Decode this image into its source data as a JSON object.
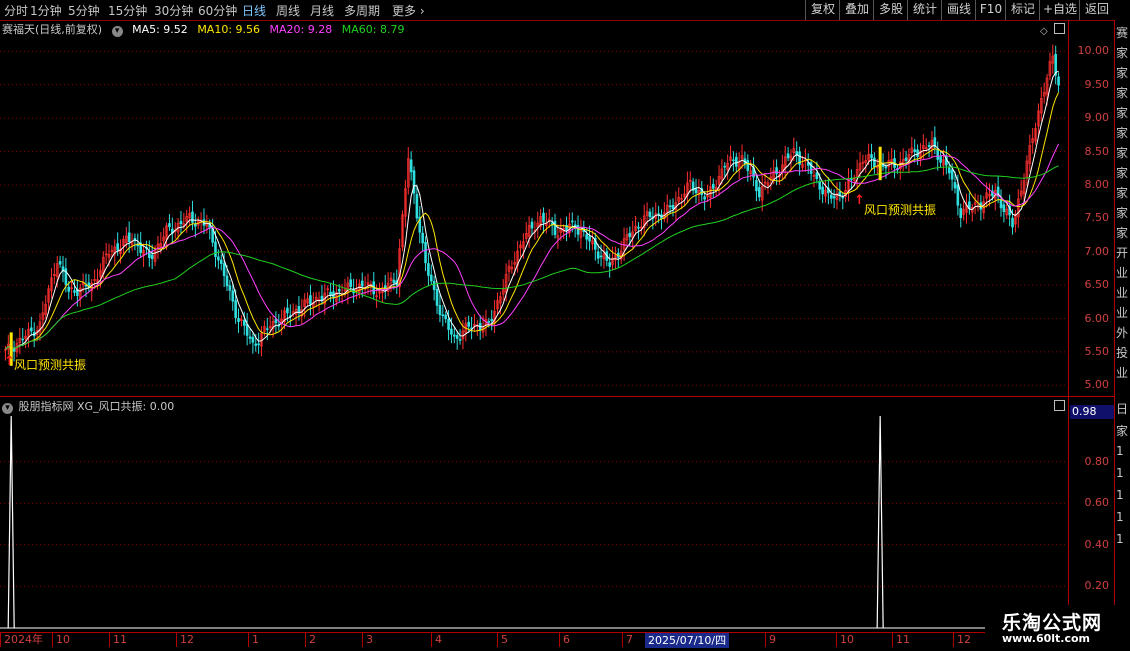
{
  "toolbar": {
    "periods": [
      "分时",
      "1分钟",
      "5分钟",
      "15分钟",
      "30分钟",
      "60分钟",
      "日线",
      "周线",
      "月线",
      "多周期",
      "更多"
    ],
    "active_period": "日线",
    "right_buttons": [
      "复权",
      "叠加",
      "多股",
      "统计",
      "画线",
      "F10",
      "标记",
      "+自选",
      "返回"
    ]
  },
  "main_info": {
    "stock": "赛福天(日线,前复权)",
    "ma5": "MA5: 9.52",
    "ma10": "MA10: 9.56",
    "ma20": "MA20: 9.28",
    "ma60": "MA60: 8.79"
  },
  "sub_info": {
    "label": "股朋指标网 XG_风口共振: 0.00",
    "current_value": "0.98"
  },
  "signals": [
    {
      "label": "风口预测共振"
    },
    {
      "label": "风口预测共振"
    }
  ],
  "price_axis": [
    "10.00",
    "9.50",
    "9.00",
    "8.50",
    "8.00",
    "7.50",
    "7.00",
    "6.50",
    "6.00",
    "5.50",
    "5.00"
  ],
  "indicator_axis": [
    "0.80",
    "0.60",
    "0.40",
    "0.20"
  ],
  "time_axis": {
    "months": [
      "2024年",
      "10",
      "11",
      "12",
      "1",
      "2",
      "3",
      "4",
      "5",
      "6",
      "7",
      "8",
      "9",
      "10",
      "11",
      "12"
    ],
    "cursor_date": "2025/07/10/四"
  },
  "right_strip_chars": [
    "赛",
    "家",
    "家",
    "家",
    "家",
    "家",
    "家",
    "家",
    "家",
    "家",
    "家",
    "开",
    "业",
    "业",
    "业",
    "外",
    "投",
    "业"
  ],
  "right_strip_sub_chars": [
    "日",
    "家",
    "1",
    "1",
    "1",
    "1",
    "1"
  ],
  "watermark": {
    "line1": "乐淘公式网",
    "line2": "www.60lt.com"
  },
  "colors": {
    "up": "#ff3030",
    "down": "#30e0e0",
    "ma5": "#ffffff",
    "ma10": "#ffe600",
    "ma20": "#ff40ff",
    "ma60": "#20d020",
    "grid": "#8b0000",
    "signal": "#ffe600"
  },
  "chart_data": {
    "type": "candlestick",
    "price_range": [
      4.9,
      10.2
    ],
    "closes_keypoints": [
      [
        0,
        5.5
      ],
      [
        6,
        5.7
      ],
      [
        12,
        5.9
      ],
      [
        18,
        6.9
      ],
      [
        22,
        6.4
      ],
      [
        30,
        6.5
      ],
      [
        36,
        7.0
      ],
      [
        44,
        7.2
      ],
      [
        50,
        6.9
      ],
      [
        56,
        7.3
      ],
      [
        64,
        7.5
      ],
      [
        70,
        7.4
      ],
      [
        74,
        6.9
      ],
      [
        80,
        6.1
      ],
      [
        86,
        5.6
      ],
      [
        92,
        5.9
      ],
      [
        100,
        6.1
      ],
      [
        108,
        6.3
      ],
      [
        116,
        6.4
      ],
      [
        124,
        6.5
      ],
      [
        130,
        6.4
      ],
      [
        136,
        6.6
      ],
      [
        140,
        8.4
      ],
      [
        146,
        6.8
      ],
      [
        152,
        6.0
      ],
      [
        156,
        5.7
      ],
      [
        162,
        5.9
      ],
      [
        168,
        5.9
      ],
      [
        174,
        6.6
      ],
      [
        180,
        7.2
      ],
      [
        186,
        7.5
      ],
      [
        192,
        7.3
      ],
      [
        198,
        7.4
      ],
      [
        204,
        7.1
      ],
      [
        210,
        6.8
      ],
      [
        216,
        7.2
      ],
      [
        222,
        7.5
      ],
      [
        230,
        7.6
      ],
      [
        238,
        8.0
      ],
      [
        244,
        7.8
      ],
      [
        250,
        8.3
      ],
      [
        256,
        8.4
      ],
      [
        262,
        7.9
      ],
      [
        268,
        8.2
      ],
      [
        274,
        8.5
      ],
      [
        280,
        8.2
      ],
      [
        286,
        7.8
      ],
      [
        292,
        7.9
      ],
      [
        298,
        8.4
      ],
      [
        304,
        8.3
      ],
      [
        310,
        8.3
      ],
      [
        316,
        8.5
      ],
      [
        322,
        8.6
      ],
      [
        328,
        8.2
      ],
      [
        332,
        7.6
      ],
      [
        338,
        7.7
      ],
      [
        344,
        7.9
      ],
      [
        350,
        7.4
      ],
      [
        356,
        8.5
      ],
      [
        360,
        9.3
      ],
      [
        364,
        9.9
      ],
      [
        366,
        9.52
      ]
    ],
    "signal_bars": [
      2,
      304
    ]
  }
}
